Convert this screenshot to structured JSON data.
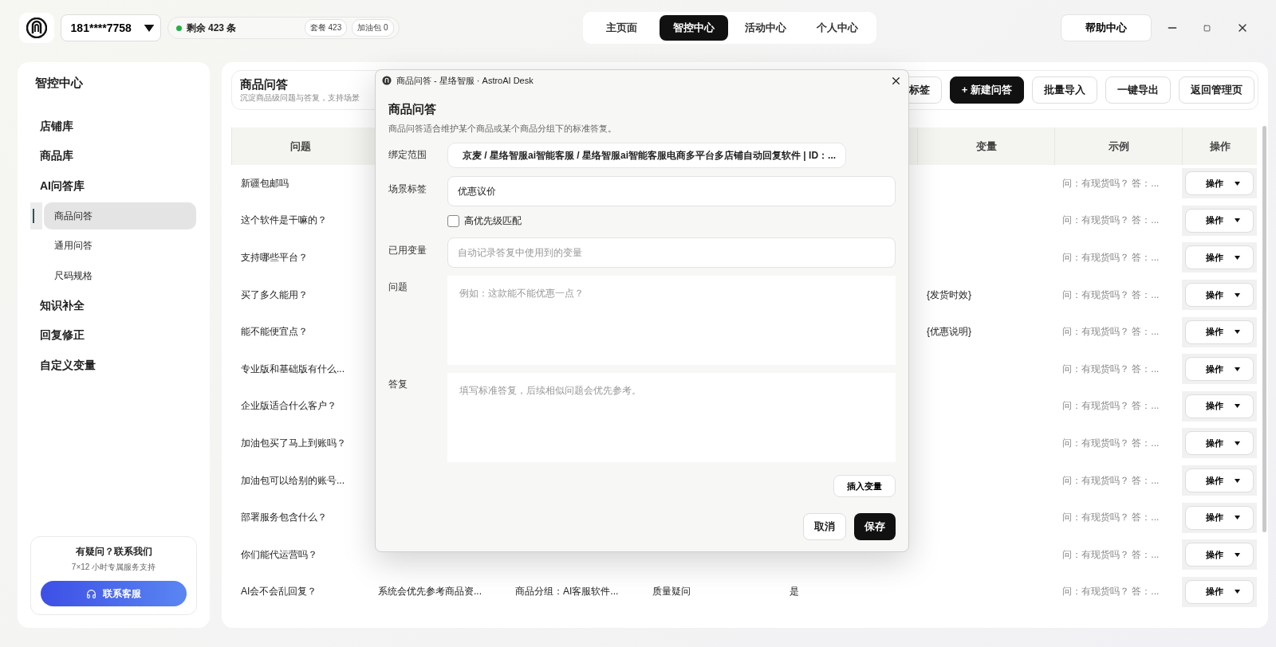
{
  "topbar": {
    "account": "181****7758",
    "balance": "剩余 423 条",
    "chips": [
      "套餐 423",
      "加油包 0"
    ],
    "nav": [
      {
        "label": "主页面",
        "selected": false
      },
      {
        "label": "智控中心",
        "selected": true
      },
      {
        "label": "活动中心",
        "selected": false
      },
      {
        "label": "个人中心",
        "selected": false
      }
    ],
    "help": "帮助中心"
  },
  "sidebar": {
    "title": "智控中心",
    "items": [
      {
        "label": "店铺库"
      },
      {
        "label": "商品库"
      },
      {
        "label": "AI问答库",
        "children": [
          {
            "label": "商品问答",
            "selected": true
          },
          {
            "label": "通用问答",
            "selected": false
          },
          {
            "label": "尺码规格",
            "selected": false
          }
        ]
      },
      {
        "label": "知识补全"
      },
      {
        "label": "回复修正"
      },
      {
        "label": "自定义变量"
      }
    ],
    "contact": {
      "title": "有疑问？联系我们",
      "subtitle": "7×12 小时专属服务支持",
      "button": "联系客服"
    }
  },
  "page": {
    "title": "商品问答",
    "subtitle": "沉淀商品级问题与答复，支持场景",
    "buttons": [
      {
        "label": "标签",
        "kind": "outline"
      },
      {
        "label": "+ 新建问答",
        "kind": "primary"
      },
      {
        "label": "批量导入",
        "kind": "outline"
      },
      {
        "label": "一键导出",
        "kind": "outline"
      },
      {
        "label": "返回管理页",
        "kind": "outline"
      }
    ]
  },
  "table": {
    "columns": [
      {
        "label": "问题"
      },
      {
        "label": "变量"
      },
      {
        "label": "示例"
      },
      {
        "label": "操作"
      }
    ],
    "rows": [
      {
        "question": "新疆包邮吗",
        "example": "问：有现货吗？ 答：...",
        "action": "操作"
      },
      {
        "question": "这个软件是干嘛的？",
        "example": "问：有现货吗？ 答：...",
        "action": "操作"
      },
      {
        "question": "支持哪些平台？",
        "example": "问：有现货吗？ 答：...",
        "action": "操作"
      },
      {
        "question": "买了多久能用？",
        "variable": "{发货时效}",
        "example": "问：有现货吗？ 答：...",
        "action": "操作"
      },
      {
        "question": "能不能便宜点？",
        "variable": "{优惠说明}",
        "example": "问：有现货吗？ 答：...",
        "action": "操作"
      },
      {
        "question": "专业版和基础版有什么...",
        "example": "问：有现货吗？ 答：...",
        "action": "操作"
      },
      {
        "question": "企业版适合什么客户？",
        "example": "问：有现货吗？ 答：...",
        "action": "操作"
      },
      {
        "question": "加油包买了马上到账吗？",
        "example": "问：有现货吗？ 答：...",
        "action": "操作"
      },
      {
        "question": "加油包可以给别的账号...",
        "example": "问：有现货吗？ 答：...",
        "action": "操作"
      },
      {
        "question": "部署服务包含什么？",
        "example": "问：有现货吗？ 答：...",
        "action": "操作"
      },
      {
        "question": "你们能代运营吗？",
        "example": "问：有现货吗？ 答：...",
        "action": "操作"
      },
      {
        "question": "AI会不会乱回复？",
        "answer": "系统会优先参考商品资...",
        "scope": "商品分组：AI客服软件...",
        "scene": "质量疑问",
        "priority": "是",
        "example": "问：有现货吗？ 答：...",
        "action": "操作"
      }
    ]
  },
  "dialog": {
    "title": "商品问答 - 星络智服 · AstroAI Desk",
    "heading": "商品问答",
    "description": "商品问答适合维护某个商品或某个商品分组下的标准答复。",
    "fields": [
      {
        "kind": "scope",
        "label": "绑定范围",
        "value": "京麦 / 星络智服ai智能客服 / 星络智服ai智能客服电商多平台多店铺自动回复软件 | ID：..."
      },
      {
        "kind": "input",
        "label": "场景标签",
        "value": "优惠议价"
      },
      {
        "kind": "checkbox",
        "label": "高优先级匹配",
        "checked": false
      },
      {
        "kind": "input",
        "label": "已用变量",
        "placeholder": "自动记录答复中使用到的变量"
      },
      {
        "kind": "textarea",
        "label": "问题",
        "placeholder": "例如：这款能不能优惠一点？"
      },
      {
        "kind": "textarea",
        "label": "答复",
        "placeholder": "填写标准答复，后续相似问题会优先参考。"
      }
    ],
    "insert_button": "插入变量",
    "buttons": [
      {
        "label": "取消",
        "kind": "secondary"
      },
      {
        "label": "保存",
        "kind": "primary"
      }
    ]
  }
}
